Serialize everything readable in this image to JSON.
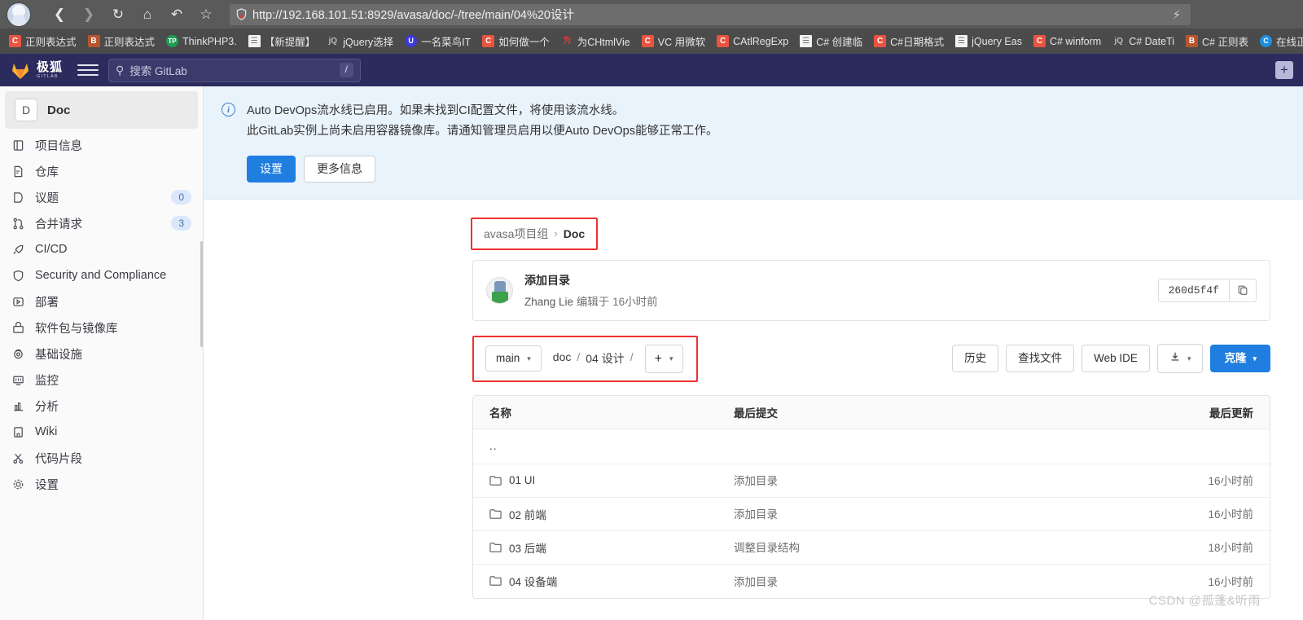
{
  "browser": {
    "nav": {
      "back_icon": "back-arrow-icon",
      "forward_icon": "forward-arrow-icon",
      "reload_icon": "reload-icon",
      "home_icon": "home-icon",
      "history_icon": "undo-history-icon",
      "bookmark_icon": "star-icon",
      "lightning_icon": "lightning-icon"
    },
    "url": {
      "scheme": "http://",
      "host": "192.168.101.51",
      "rest": ":8929/avasa/doc/-/tree/main/04%20设计",
      "full": "http://192.168.101.51:8929/avasa/doc/-/tree/main/04%20设计",
      "security_icon": "shield-blocked-icon"
    },
    "bookmarks": [
      {
        "label": "正则表达式",
        "icon": "csdn-icon",
        "style": "bm-csdn",
        "glyph": "C"
      },
      {
        "label": "正则表达式",
        "icon": "cnblogs-icon",
        "style": "bm-cnblogs",
        "glyph": "B"
      },
      {
        "label": "ThinkPHP3.",
        "icon": "thinkphp-icon",
        "style": "bm-thinkphp",
        "glyph": "TP"
      },
      {
        "label": "【新提醒】",
        "icon": "document-icon",
        "style": "bm-doc",
        "glyph": "☰"
      },
      {
        "label": "jQuery选择",
        "icon": "jquery-icon",
        "style": "bm-jq",
        "glyph": "jQ"
      },
      {
        "label": "一名菜鸟IT",
        "icon": "rookie-icon",
        "style": "bm-niao",
        "glyph": "U"
      },
      {
        "label": "如何做一个",
        "icon": "csdn-icon",
        "style": "bm-csdn",
        "glyph": "C"
      },
      {
        "label": "为CHtmlVie",
        "icon": "red-icon",
        "style": "bm-red",
        "glyph": "为"
      },
      {
        "label": "VC 用微软",
        "icon": "csdn-icon",
        "style": "bm-csdn",
        "glyph": "C"
      },
      {
        "label": "CAtlRegExp",
        "icon": "csdn-icon",
        "style": "bm-csdn",
        "glyph": "C"
      },
      {
        "label": "C# 创建临",
        "icon": "document-icon",
        "style": "bm-doc",
        "glyph": "☰"
      },
      {
        "label": "C#日期格式",
        "icon": "csdn-icon",
        "style": "bm-csdn",
        "glyph": "C"
      },
      {
        "label": "jQuery Eas",
        "icon": "document-icon",
        "style": "bm-doc",
        "glyph": "☰"
      },
      {
        "label": "C# winform",
        "icon": "csdn-icon",
        "style": "bm-csdn",
        "glyph": "C"
      },
      {
        "label": "C# DateTi",
        "icon": "jquery-icon",
        "style": "bm-jq",
        "glyph": "jQ"
      },
      {
        "label": "C# 正则表",
        "icon": "cnblogs-icon",
        "style": "bm-cnblogs",
        "glyph": "B"
      },
      {
        "label": "在线正则表",
        "icon": "globe-icon",
        "style": "bm-blue",
        "glyph": "C"
      }
    ]
  },
  "navbar": {
    "logo_cn": "极狐",
    "logo_en": "GITLAB",
    "logo_icon": "gitlab-fox-icon",
    "menu_icon": "hamburger-menu-icon",
    "search_placeholder": "搜索 GitLab",
    "search_icon": "search-icon",
    "search_shortcut": "/",
    "plus_label": "+",
    "plus_icon": "plus-icon"
  },
  "sidebar": {
    "project": {
      "initial": "D",
      "name": "Doc",
      "avatar_icon": "project-avatar-icon"
    },
    "items": [
      {
        "label": "项目信息",
        "icon": "project-info-icon",
        "badge": ""
      },
      {
        "label": "仓库",
        "icon": "repository-icon",
        "badge": ""
      },
      {
        "label": "议题",
        "icon": "issues-icon",
        "badge": "0"
      },
      {
        "label": "合并请求",
        "icon": "merge-request-icon",
        "badge": "3"
      },
      {
        "label": "CI/CD",
        "icon": "rocket-icon",
        "badge": ""
      },
      {
        "label": "Security and Compliance",
        "icon": "shield-icon",
        "badge": ""
      },
      {
        "label": "部署",
        "icon": "deploy-icon",
        "badge": ""
      },
      {
        "label": "软件包与镜像库",
        "icon": "package-icon",
        "badge": ""
      },
      {
        "label": "基础设施",
        "icon": "infrastructure-icon",
        "badge": ""
      },
      {
        "label": "监控",
        "icon": "monitor-icon",
        "badge": ""
      },
      {
        "label": "分析",
        "icon": "analytics-icon",
        "badge": ""
      },
      {
        "label": "Wiki",
        "icon": "wiki-book-icon",
        "badge": ""
      },
      {
        "label": "代码片段",
        "icon": "snippet-scissors-icon",
        "badge": ""
      },
      {
        "label": "设置",
        "icon": "gear-icon",
        "badge": ""
      }
    ]
  },
  "alert": {
    "icon": "info-circle-icon",
    "line1": "Auto DevOps流水线已启用。如果未找到CI配置文件，将使用该流水线。",
    "line2": "此GitLab实例上尚未启用容器镜像库。请通知管理员启用以便Auto DevOps能够正常工作。",
    "primary_button": "设置",
    "secondary_button": "更多信息"
  },
  "breadcrumb": {
    "group": "avasa项目组",
    "separator": "›",
    "current": "Doc"
  },
  "commit": {
    "title": "添加目录",
    "author": "Zhang Lie",
    "meta_suffix": "编辑于 16小时前",
    "sha": "260d5f4f",
    "copy_icon": "copy-clipboard-icon",
    "avatar_icon": "user-avatar-icon"
  },
  "path_toolbar": {
    "branch": "main",
    "branch_caret": "▾",
    "crumbs": [
      "doc",
      "/",
      "04 设计",
      "/"
    ],
    "add_label": "+",
    "add_caret": "▾",
    "add_icon": "plus-icon",
    "history_button": "历史",
    "find_file_button": "查找文件",
    "web_ide_button": "Web IDE",
    "download_icon": "download-icon",
    "download_caret": "▾",
    "clone_button": "克隆",
    "clone_caret": "▾"
  },
  "file_table": {
    "headers": {
      "name": "名称",
      "commit": "最后提交",
      "updated": "最后更新"
    },
    "parent_dir": "..",
    "rows": [
      {
        "name": "01 UI",
        "icon": "folder-icon",
        "commit": "添加目录",
        "updated": "16小时前"
      },
      {
        "name": "02 前端",
        "icon": "folder-icon",
        "commit": "添加目录",
        "updated": "16小时前"
      },
      {
        "name": "03 后端",
        "icon": "folder-icon",
        "commit": "调整目录结构",
        "updated": "18小时前"
      },
      {
        "name": "04 设备端",
        "icon": "folder-icon",
        "commit": "添加目录",
        "updated": "16小时前"
      }
    ]
  },
  "watermark": "CSDN @孤蓬&听雨",
  "colors": {
    "navbar_bg": "#2b2b5e",
    "accent_blue": "#1f7ee0",
    "alert_bg": "#e9f3fc",
    "highlight_red": "#f03030",
    "badge_bg": "#dbe7fb",
    "chrome_bg": "#5a5a5a",
    "bookmark_bg": "#4b4b4b"
  }
}
